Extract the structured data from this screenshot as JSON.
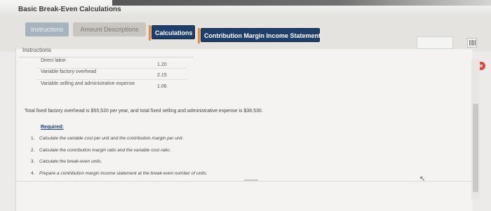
{
  "window": {
    "title": "Basic Break-Even Calculations"
  },
  "tabs": [
    {
      "label": "Instructions"
    },
    {
      "label": "Amount Descriptions"
    },
    {
      "label": "Calculations"
    },
    {
      "label": "Contribution Margin Income Statement"
    }
  ],
  "panel": {
    "heading": "Instructions",
    "rows": [
      {
        "label": "Direct labor",
        "value": "1.20"
      },
      {
        "label": "Variable factory overhead",
        "value": "2.15"
      },
      {
        "label": "Variable selling and administrative expense",
        "value": "1.06"
      }
    ],
    "fixed_costs_text": "Total fixed factory overhead is $55,520 per year, and total fixed selling and administrative expense is $38,530.",
    "required_label": "Required:",
    "required_items": [
      {
        "num": "1.",
        "text": "Calculate the variable cost per unit and the contribution margin per unit."
      },
      {
        "num": "2.",
        "text": "Calculate the contribution margin ratio and the variable cost ratio."
      },
      {
        "num": "3.",
        "text": "Calculate the break-even units."
      },
      {
        "num": "4.",
        "text": "Prepare a contribution margin income statement at the break-even number of units."
      }
    ]
  },
  "icons": {
    "grid": "grid-icon",
    "close": "close-icon",
    "cursor": "cursor-icon"
  },
  "colors": {
    "active_tab": "#1f3f6a",
    "tab_separator": "#f08a2a",
    "required_link": "#1c3c86",
    "close_button": "#d8463e"
  }
}
